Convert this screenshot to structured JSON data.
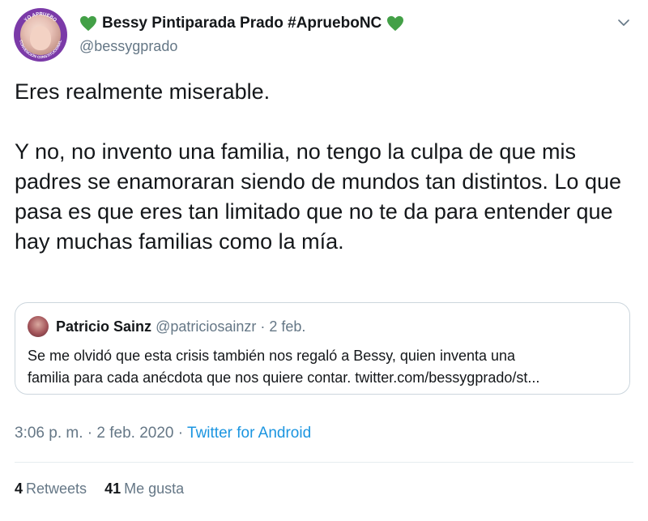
{
  "author": {
    "display_name": "Bessy Pintiparada Prado #AprueboNC",
    "handle": "@bessygprado",
    "heart_color": "#43a047",
    "avatar_badge_text_top": "YO APRUEBO",
    "avatar_badge_text_bottom": "CONVENCIÓN CONSTITUCIONAL"
  },
  "tweet": {
    "text": "Eres realmente miserable.\n\nY no, no invento una familia, no tengo la culpa de que mis padres se enamoraran siendo de mundos tan distintos. Lo que pasa es que eres tan limitado que no te da para entender que hay muchas familias como la mía."
  },
  "quoted_tweet": {
    "name": "Patricio Sainz",
    "handle": "@patriciosainzr",
    "date": "2 feb.",
    "text_line1": "Se me olvidó que esta crisis también nos regaló a Bessy, quien inventa una",
    "text_line2": "familia para cada anécdota que nos quiere contar. twitter.com/bessygprado/st..."
  },
  "meta": {
    "timestamp": "3:06 p. m. · 2 feb. 2020",
    "separator": " · ",
    "source": "Twitter for Android"
  },
  "stats": {
    "retweets_count": "4",
    "retweets_label": "Retweets",
    "likes_count": "41",
    "likes_label": "Me gusta"
  },
  "icons": {
    "heart": "green-heart-icon",
    "chevron": "chevron-down-icon"
  },
  "colors": {
    "text_primary": "#14171a",
    "text_secondary": "#657786",
    "link": "#1b95e0",
    "border": "#ccd6dd"
  }
}
